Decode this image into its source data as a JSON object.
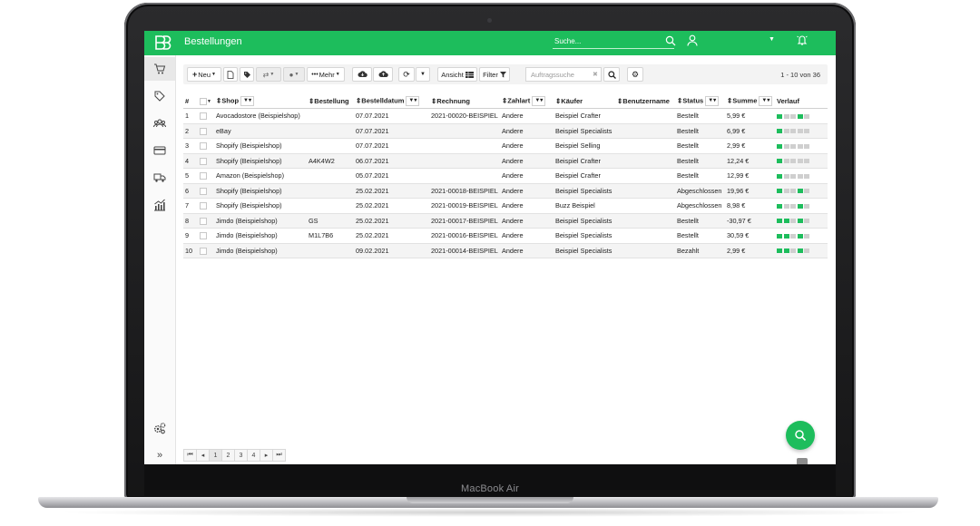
{
  "device": {
    "label": "MacBook Air"
  },
  "header": {
    "title": "Bestellungen",
    "search_placeholder": "Suche..."
  },
  "sidebar": {
    "items": [
      {
        "name": "cart-icon"
      },
      {
        "name": "tag-icon"
      },
      {
        "name": "users-icon"
      },
      {
        "name": "credit-card-icon"
      },
      {
        "name": "truck-icon"
      },
      {
        "name": "chart-icon"
      },
      {
        "name": "settings-gears-icon"
      },
      {
        "name": "expand-icon"
      }
    ],
    "expand_label": "»"
  },
  "toolbar": {
    "new_label": "Neu",
    "more_label": "Mehr",
    "view_label": "Ansicht",
    "filter_label": "Filter",
    "search_placeholder": "Auftragssuche",
    "range_label": "1 - 10 von 36"
  },
  "table": {
    "columns": {
      "num": "#",
      "shop": "Shop",
      "order": "Bestellung",
      "date": "Bestelldatum",
      "invoice": "Rechnung",
      "payment": "Zahlart",
      "buyer": "Käufer",
      "username": "Benutzername",
      "status": "Status",
      "total": "Summe",
      "history": "Verlauf"
    },
    "rows": [
      {
        "num": "1",
        "shop": "Avocadostore (Beispielshop)",
        "order": "",
        "date": "07.07.2021",
        "invoice": "2021-00020-BEISPIEL",
        "payment": "Andere",
        "buyer": "Beispiel Crafter",
        "username": "",
        "status": "Bestellt",
        "total": "5,99 €"
      },
      {
        "num": "2",
        "shop": "eBay",
        "order": "",
        "date": "07.07.2021",
        "invoice": "",
        "payment": "Andere",
        "buyer": "Beispiel Specialists",
        "username": "",
        "status": "Bestellt",
        "total": "6,99 €"
      },
      {
        "num": "3",
        "shop": "Shopify (Beispielshop)",
        "order": "",
        "date": "07.07.2021",
        "invoice": "",
        "payment": "Andere",
        "buyer": "Beispiel Selling",
        "username": "",
        "status": "Bestellt",
        "total": "2,99 €"
      },
      {
        "num": "4",
        "shop": "Shopify (Beispielshop)",
        "order": "A4K4W2",
        "date": "06.07.2021",
        "invoice": "",
        "payment": "Andere",
        "buyer": "Beispiel Crafter",
        "username": "",
        "status": "Bestellt",
        "total": "12,24 €"
      },
      {
        "num": "5",
        "shop": "Amazon (Beispielshop)",
        "order": "",
        "date": "05.07.2021",
        "invoice": "",
        "payment": "Andere",
        "buyer": "Beispiel Crafter",
        "username": "",
        "status": "Bestellt",
        "total": "12,99 €"
      },
      {
        "num": "6",
        "shop": "Shopify (Beispielshop)",
        "order": "",
        "date": "25.02.2021",
        "invoice": "2021-00018-BEISPIEL",
        "payment": "Andere",
        "buyer": "Beispiel Specialists",
        "username": "",
        "status": "Abgeschlossen",
        "total": "19,96 €"
      },
      {
        "num": "7",
        "shop": "Shopify (Beispielshop)",
        "order": "",
        "date": "25.02.2021",
        "invoice": "2021-00019-BEISPIEL",
        "payment": "Andere",
        "buyer": "Buzz Beispiel",
        "username": "",
        "status": "Abgeschlossen",
        "total": "8,98 €"
      },
      {
        "num": "8",
        "shop": "Jimdo (Beispielshop)",
        "order": "GS",
        "date": "25.02.2021",
        "invoice": "2021-00017-BEISPIEL",
        "payment": "Andere",
        "buyer": "Beispiel Specialists",
        "username": "",
        "status": "Bestellt",
        "total": "-30,97 €"
      },
      {
        "num": "9",
        "shop": "Jimdo (Beispielshop)",
        "order": "M1L7B6",
        "date": "25.02.2021",
        "invoice": "2021-00016-BEISPIEL",
        "payment": "Andere",
        "buyer": "Beispiel Specialists",
        "username": "",
        "status": "Bestellt",
        "total": "30,59 €"
      },
      {
        "num": "10",
        "shop": "Jimdo (Beispielshop)",
        "order": "",
        "date": "09.02.2021",
        "invoice": "2021-00014-BEISPIEL",
        "payment": "Andere",
        "buyer": "Beispiel Specialists",
        "username": "",
        "status": "Bezahlt",
        "total": "2,99 €"
      }
    ]
  },
  "pagination": {
    "pages": [
      "1",
      "2",
      "3",
      "4"
    ],
    "current": "1"
  },
  "colors": {
    "brand_green": "#1dbd5c",
    "muted_icon": "#cfcfcf"
  }
}
